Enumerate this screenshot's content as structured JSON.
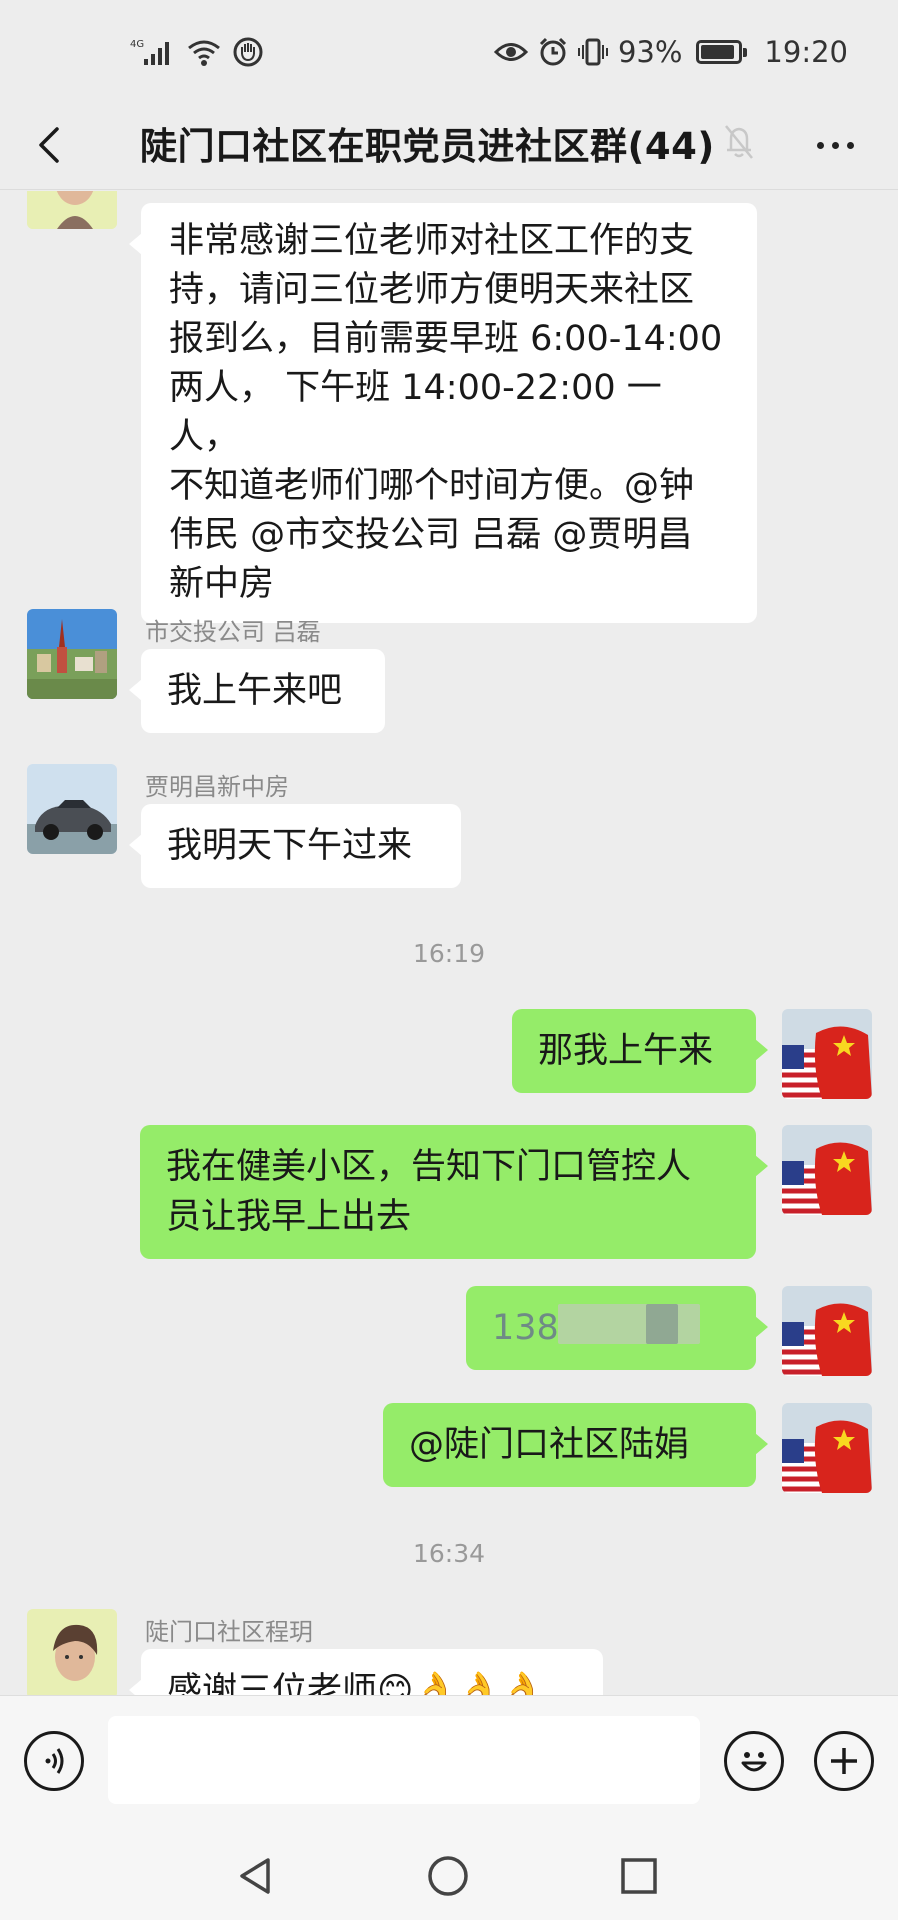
{
  "status_bar": {
    "network": "4G",
    "battery_percent": "93%",
    "battery_level": 0.93,
    "time": "19:20",
    "icons": [
      "signal-icon",
      "wifi-icon",
      "hand-icon",
      "eye-icon",
      "alarm-icon",
      "vibrate-icon",
      "battery-icon"
    ]
  },
  "header": {
    "title": "陡门口社区在职党员进社区群(44)",
    "back_icon": "chevron-left-icon",
    "mute_icon": "bell-muted-icon",
    "more_icon": "more-dots-icon"
  },
  "colors": {
    "background": "#ededed",
    "incoming_bubble": "#ffffff",
    "outgoing_bubble": "#95ec69",
    "timestamp": "#999999",
    "sender": "#8a8a8a"
  },
  "messages": [
    {
      "direction": "in",
      "sender": "",
      "lines": [
        "非常感谢三位老师对社区工作的支",
        "持，请问三位老师方便明天来社区",
        "报到么，目前需要早班 6:00-14:00",
        "两人， 下午班 14:00-22:00 一人，",
        "不知道老师们哪个时间方便。@钟",
        "伟民 @市交投公司 吕磊 @贾明昌",
        "新中房"
      ]
    },
    {
      "direction": "in",
      "sender": "市交投公司 吕磊",
      "text": "我上午来吧"
    },
    {
      "direction": "in",
      "sender": "贾明昌新中房",
      "text": "我明天下午过来"
    },
    {
      "type": "time",
      "text": "16:19"
    },
    {
      "direction": "out",
      "text": "那我上午来"
    },
    {
      "direction": "out",
      "lines": [
        "我在健美小区，告知下门口管控人",
        "员让我早上出去"
      ]
    },
    {
      "direction": "out",
      "text": "138"
    },
    {
      "direction": "out",
      "text": "@陡门口社区陆娟"
    },
    {
      "type": "time",
      "text": "16:34"
    },
    {
      "direction": "in",
      "sender": "陡门口社区程玥",
      "text": "感谢三位老师😊👌👌👌"
    }
  ],
  "input_bar": {
    "voice_icon": "voice-icon",
    "emoji_icon": "emoji-icon",
    "add_icon": "plus-circle-icon",
    "value": ""
  },
  "nav_bar": {
    "back_icon": "nav-back-icon",
    "home_icon": "nav-home-icon",
    "recents_icon": "nav-recents-icon"
  }
}
